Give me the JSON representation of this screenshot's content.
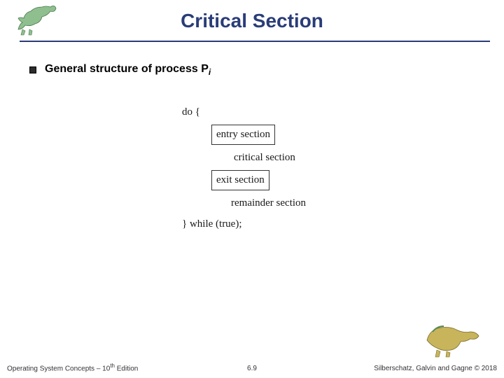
{
  "header": {
    "title": "Critical Section"
  },
  "bullet": {
    "text_prefix": "General structure of process ",
    "process_symbol": "P",
    "process_subscript": "i"
  },
  "code": {
    "do_open": "do {",
    "entry": "entry section",
    "critical": "critical section",
    "exit": "exit section",
    "remainder": "remainder section",
    "while_close": "} while (true);"
  },
  "footer": {
    "left_prefix": "Operating System Concepts – 10",
    "left_suffix": " Edition",
    "left_sup": "th",
    "center": "6.9",
    "right": "Silberschatz, Galvin and Gagne © 2018"
  },
  "icons": {
    "dino_left": "dinosaur-icon",
    "dino_right": "dinosaur-icon"
  }
}
